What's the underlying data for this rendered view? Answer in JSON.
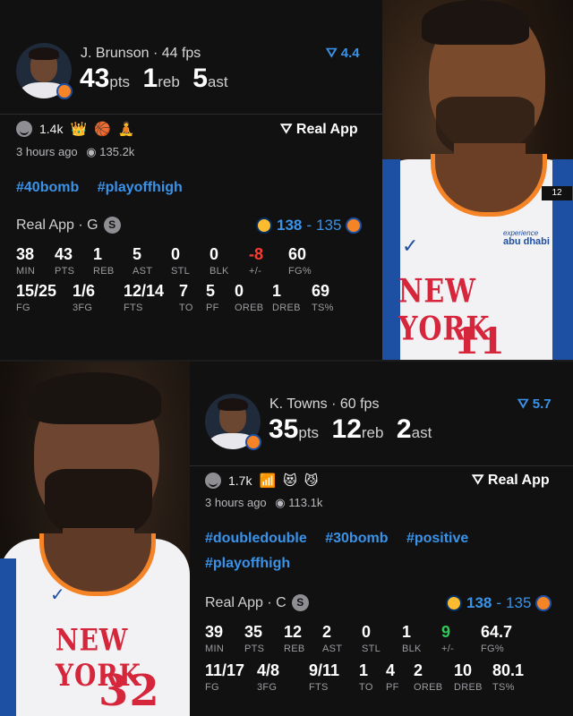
{
  "cards": [
    {
      "player": "J. Brunson",
      "fps": "44 fps",
      "pts": "43",
      "pts_unit": "pts",
      "reb": "1",
      "reb_unit": "reb",
      "ast": "5",
      "ast_unit": "ast",
      "rating": "4.4",
      "reactions_count": "1.4k",
      "reaction_emojis": [
        "👑",
        "🏀",
        "🧘"
      ],
      "real_app": "Real App",
      "time": "3 hours ago",
      "views": "135.2k",
      "hashtags": [
        "#40bomb",
        "#playoffhigh"
      ],
      "source": "Real App · G",
      "source_badge": "S",
      "score_home": "138",
      "score_dash": "-",
      "score_away": "135",
      "stats_row1": [
        {
          "v": "38",
          "l": "MIN"
        },
        {
          "v": "43",
          "l": "PTS"
        },
        {
          "v": "1",
          "l": "REB"
        },
        {
          "v": "5",
          "l": "AST"
        },
        {
          "v": "0",
          "l": "STL"
        },
        {
          "v": "0",
          "l": "BLK"
        },
        {
          "v": "-8",
          "l": "+/-"
        },
        {
          "v": "60",
          "l": "FG%"
        }
      ],
      "stats_row2": [
        {
          "v": "15/25",
          "l": "FG"
        },
        {
          "v": "1/6",
          "l": "3FG"
        },
        {
          "v": "12/14",
          "l": "FTS"
        },
        {
          "v": "7",
          "l": "TO"
        },
        {
          "v": "5",
          "l": "PF"
        },
        {
          "v": "0",
          "l": "OREB"
        },
        {
          "v": "1",
          "l": "DREB"
        },
        {
          "v": "69",
          "l": "TS%"
        }
      ],
      "jersey_text": "NEW YORK",
      "jersey_number": "11",
      "sponsor": "abu dhabi",
      "sponsor_small": "experience"
    },
    {
      "player": "K. Towns",
      "fps": "60 fps",
      "pts": "35",
      "pts_unit": "pts",
      "reb": "12",
      "reb_unit": "reb",
      "ast": "2",
      "ast_unit": "ast",
      "rating": "5.7",
      "reactions_count": "1.7k",
      "reaction_emojis": [
        "📶",
        "😻",
        "😼"
      ],
      "real_app": "Real App",
      "time": "3 hours ago",
      "views": "113.1k",
      "hashtags": [
        "#doubledouble",
        "#30bomb",
        "#positive",
        "#playoffhigh"
      ],
      "source": "Real App · C",
      "source_badge": "S",
      "score_home": "138",
      "score_dash": "-",
      "score_away": "135",
      "stats_row1": [
        {
          "v": "39",
          "l": "MIN"
        },
        {
          "v": "35",
          "l": "PTS"
        },
        {
          "v": "12",
          "l": "REB"
        },
        {
          "v": "2",
          "l": "AST"
        },
        {
          "v": "0",
          "l": "STL"
        },
        {
          "v": "1",
          "l": "BLK"
        },
        {
          "v": "9",
          "l": "+/-"
        },
        {
          "v": "64.7",
          "l": "FG%"
        }
      ],
      "stats_row2": [
        {
          "v": "11/17",
          "l": "FG"
        },
        {
          "v": "4/8",
          "l": "3FG"
        },
        {
          "v": "9/11",
          "l": "FTS"
        },
        {
          "v": "1",
          "l": "TO"
        },
        {
          "v": "4",
          "l": "PF"
        },
        {
          "v": "2",
          "l": "OREB"
        },
        {
          "v": "10",
          "l": "DREB"
        },
        {
          "v": "80.1",
          "l": "TS%"
        }
      ],
      "jersey_text": "NEW YORK",
      "jersey_number": "32"
    }
  ],
  "colors": {
    "accent": "#3a93e8",
    "negative": "#ff3b30",
    "positive": "#34c759",
    "knicks_orange": "#f58426",
    "knicks_blue": "#1d4fa3",
    "pacers_gold": "#fdbb30"
  }
}
